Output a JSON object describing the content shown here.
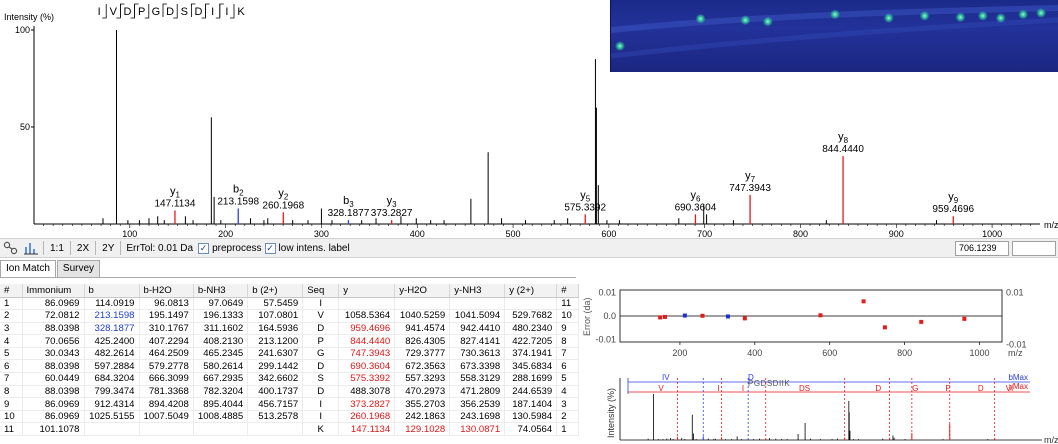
{
  "spectrum": {
    "y_axis_label": "Intensity (%)",
    "y_ticks": [
      {
        "value": 100,
        "label": "100"
      },
      {
        "value": 50,
        "label": "50"
      }
    ],
    "x_axis_label": "m/z",
    "x_ticks": [
      {
        "value": 100,
        "label": "100"
      },
      {
        "value": 200,
        "label": "200"
      },
      {
        "value": 300,
        "label": "300"
      },
      {
        "value": 400,
        "label": "400"
      },
      {
        "value": 500,
        "label": "500"
      },
      {
        "value": 600,
        "label": "600"
      },
      {
        "value": 700,
        "label": "700"
      },
      {
        "value": 800,
        "label": "800"
      },
      {
        "value": 900,
        "label": "900"
      },
      {
        "value": 1000,
        "label": "1000"
      }
    ],
    "xlim": [
      0,
      1050
    ],
    "ylim": [
      0,
      100
    ],
    "sequence": [
      "I",
      "V",
      "D",
      "P",
      "G",
      "D",
      "S",
      "D",
      "I",
      "I",
      "K"
    ],
    "sequence_b_breaks": [
      2,
      3,
      5,
      7,
      8,
      9
    ],
    "sequence_y_breaks": [
      1,
      2,
      3,
      4,
      6,
      8,
      9,
      10
    ],
    "annotated_peaks": [
      {
        "ion": "y",
        "sub": "1",
        "mz": 147.1134,
        "label": "147.1134",
        "intensity": 7,
        "type": "y"
      },
      {
        "ion": "b",
        "sub": "2",
        "mz": 213.1598,
        "label": "213.1598",
        "intensity": 8,
        "type": "b"
      },
      {
        "ion": "y",
        "sub": "2",
        "mz": 260.1968,
        "label": "260.1968",
        "intensity": 6,
        "type": "y"
      },
      {
        "ion": "b",
        "sub": "3",
        "mz": 328.1877,
        "label": "328.1877",
        "intensity": 2,
        "type": "b"
      },
      {
        "ion": "y",
        "sub": "3",
        "mz": 373.2827,
        "label": "373.2827",
        "intensity": 2,
        "type": "y"
      },
      {
        "ion": "y",
        "sub": "5",
        "mz": 575.3392,
        "label": "575.3392",
        "intensity": 5,
        "type": "y"
      },
      {
        "ion": "y",
        "sub": "6",
        "mz": 690.3604,
        "label": "690.3604",
        "intensity": 5,
        "type": "y"
      },
      {
        "ion": "y",
        "sub": "7",
        "mz": 747.3943,
        "label": "747.3943",
        "intensity": 15,
        "type": "y"
      },
      {
        "ion": "y",
        "sub": "8",
        "mz": 844.444,
        "label": "844.4440",
        "intensity": 35,
        "type": "y"
      },
      {
        "ion": "y",
        "sub": "9",
        "mz": 959.4696,
        "label": "959.4696",
        "intensity": 4,
        "type": "y"
      }
    ],
    "other_peaks": [
      {
        "mz": 72,
        "intensity": 3
      },
      {
        "mz": 86.1,
        "intensity": 100
      },
      {
        "mz": 98,
        "intensity": 2
      },
      {
        "mz": 110,
        "intensity": 2
      },
      {
        "mz": 120,
        "intensity": 3
      },
      {
        "mz": 129.1,
        "intensity": 4
      },
      {
        "mz": 136,
        "intensity": 2
      },
      {
        "mz": 158,
        "intensity": 4
      },
      {
        "mz": 166,
        "intensity": 2
      },
      {
        "mz": 185.1,
        "intensity": 55
      },
      {
        "mz": 188,
        "intensity": 14
      },
      {
        "mz": 195,
        "intensity": 2
      },
      {
        "mz": 226,
        "intensity": 3
      },
      {
        "mz": 240,
        "intensity": 2
      },
      {
        "mz": 244,
        "intensity": 3
      },
      {
        "mz": 270,
        "intensity": 2
      },
      {
        "mz": 286,
        "intensity": 2
      },
      {
        "mz": 300,
        "intensity": 8
      },
      {
        "mz": 311,
        "intensity": 2
      },
      {
        "mz": 342,
        "intensity": 2
      },
      {
        "mz": 357,
        "intensity": 3
      },
      {
        "mz": 383,
        "intensity": 4
      },
      {
        "mz": 399,
        "intensity": 3
      },
      {
        "mz": 414,
        "intensity": 2
      },
      {
        "mz": 428,
        "intensity": 2
      },
      {
        "mz": 456,
        "intensity": 13
      },
      {
        "mz": 474,
        "intensity": 37
      },
      {
        "mz": 488,
        "intensity": 3
      },
      {
        "mz": 513,
        "intensity": 2
      },
      {
        "mz": 543,
        "intensity": 2
      },
      {
        "mz": 557,
        "intensity": 3
      },
      {
        "mz": 586,
        "intensity": 85
      },
      {
        "mz": 587,
        "intensity": 60
      },
      {
        "mz": 589,
        "intensity": 20
      },
      {
        "mz": 598,
        "intensity": 2
      },
      {
        "mz": 611,
        "intensity": 2
      },
      {
        "mz": 673,
        "intensity": 3
      },
      {
        "mz": 699,
        "intensity": 10
      },
      {
        "mz": 702,
        "intensity": 5
      },
      {
        "mz": 730,
        "intensity": 2
      },
      {
        "mz": 827,
        "intensity": 2
      },
      {
        "mz": 942,
        "intensity": 2
      }
    ],
    "colors": {
      "b": "#2b3fe0",
      "y": "#e31c1c",
      "other": "#000000",
      "axis": "#000000"
    }
  },
  "toolbar": {
    "ratio_1_1": "1:1",
    "zoom_2x": "2X",
    "zoom_2y": "2Y",
    "err_tol_label": "ErrTol: 0.01 Da",
    "preprocess_label": "preprocess",
    "preprocess_checked": true,
    "low_intens_label": "low intens. label",
    "low_intens_checked": true,
    "mz_value": "706.1239",
    "check_mark": "✓"
  },
  "tabs": [
    {
      "label": "Ion Match",
      "active": true
    },
    {
      "label": "Survey",
      "active": false
    }
  ],
  "table": {
    "headers": [
      "#",
      "Immonium",
      "b",
      "b-H2O",
      "b-NH3",
      "b (2+)",
      "Seq",
      "y",
      "y-H2O",
      "y-NH3",
      "y (2+)",
      "#"
    ],
    "rows": [
      [
        "1",
        "86.0969",
        "114.0919",
        "96.0813",
        "97.0649",
        "57.5459",
        "I",
        "",
        "",
        "",
        "",
        "11"
      ],
      [
        "2",
        "72.0812",
        "213.1598",
        "195.1497",
        "196.1333",
        "107.0801",
        "V",
        "1058.5364",
        "1040.5259",
        "1041.5094",
        "529.7682",
        "10"
      ],
      [
        "3",
        "88.0398",
        "328.1877",
        "310.1767",
        "311.1602",
        "164.5936",
        "D",
        "959.4696",
        "941.4574",
        "942.4410",
        "480.2340",
        "9"
      ],
      [
        "4",
        "70.0656",
        "425.2400",
        "407.2294",
        "408.2130",
        "213.1200",
        "P",
        "844.4440",
        "826.4305",
        "827.4141",
        "422.7205",
        "8"
      ],
      [
        "5",
        "30.0343",
        "482.2614",
        "464.2509",
        "465.2345",
        "241.6307",
        "G",
        "747.3943",
        "729.3777",
        "730.3613",
        "374.1941",
        "7"
      ],
      [
        "6",
        "88.0398",
        "597.2884",
        "579.2778",
        "580.2614",
        "299.1442",
        "D",
        "690.3604",
        "672.3563",
        "673.3398",
        "345.6834",
        "6"
      ],
      [
        "7",
        "60.0449",
        "684.3204",
        "666.3099",
        "667.2935",
        "342.6602",
        "S",
        "575.3392",
        "557.3293",
        "558.3129",
        "288.1699",
        "5"
      ],
      [
        "8",
        "88.0398",
        "799.3474",
        "781.3368",
        "782.3204",
        "400.1737",
        "D",
        "488.3078",
        "470.2973",
        "471.2809",
        "244.6539",
        "4"
      ],
      [
        "9",
        "86.0969",
        "912.4314",
        "894.4208",
        "895.4044",
        "456.7157",
        "I",
        "373.2827",
        "355.2703",
        "356.2539",
        "187.1404",
        "3"
      ],
      [
        "10",
        "86.0969",
        "1025.5155",
        "1007.5049",
        "1008.4885",
        "513.2578",
        "I",
        "260.1968",
        "242.1863",
        "243.1698",
        "130.5984",
        "2"
      ],
      [
        "11",
        "101.1078",
        "",
        "",
        "",
        "",
        "K",
        "147.1134",
        "129.1028",
        "130.0871",
        "74.0564",
        "1"
      ]
    ],
    "highlight": [
      {
        "row": 1,
        "col": 2,
        "color": "blue"
      },
      {
        "row": 2,
        "col": 2,
        "color": "blue"
      },
      {
        "row": 2,
        "col": 7,
        "color": "red"
      },
      {
        "row": 3,
        "col": 7,
        "color": "red"
      },
      {
        "row": 4,
        "col": 7,
        "color": "red"
      },
      {
        "row": 5,
        "col": 7,
        "color": "red"
      },
      {
        "row": 6,
        "col": 7,
        "color": "red"
      },
      {
        "row": 8,
        "col": 7,
        "color": "red"
      },
      {
        "row": 9,
        "col": 7,
        "color": "red"
      },
      {
        "row": 10,
        "col": 7,
        "color": "red"
      },
      {
        "row": 10,
        "col": 8,
        "color": "red"
      },
      {
        "row": 10,
        "col": 9,
        "color": "red"
      }
    ]
  },
  "error_plot": {
    "ylabel": "Error (da)",
    "y_ticks_left": [
      {
        "value": 0.01,
        "label": "0.01"
      },
      {
        "value": 0,
        "label": "0.0"
      },
      {
        "value": -0.01,
        "label": "-0.01"
      }
    ],
    "y_ticks_right": [
      {
        "value": 0.01,
        "label": "0.01"
      },
      {
        "value": -0.01,
        "label": "-0.01"
      }
    ],
    "x_ticks": [
      {
        "value": 200,
        "label": "200"
      },
      {
        "value": 400,
        "label": "400"
      },
      {
        "value": 600,
        "label": "600"
      },
      {
        "value": 800,
        "label": "800"
      },
      {
        "value": 1000,
        "label": "1000"
      }
    ],
    "x_axis_label": "m/z",
    "xlim": [
      40,
      1060
    ],
    "ylim": [
      -0.011,
      0.011
    ],
    "points": [
      {
        "mz": 147.1,
        "err": -0.0006,
        "type": "y"
      },
      {
        "mz": 160,
        "err": -0.0004,
        "type": "y"
      },
      {
        "mz": 213.2,
        "err": 0.0002,
        "type": "b"
      },
      {
        "mz": 260.2,
        "err": 0.0001,
        "type": "y"
      },
      {
        "mz": 328.2,
        "err": -0.0002,
        "type": "b"
      },
      {
        "mz": 373.3,
        "err": -0.001,
        "type": "y"
      },
      {
        "mz": 575.3,
        "err": 0.0003,
        "type": "y"
      },
      {
        "mz": 690.4,
        "err": 0.0062,
        "type": "y"
      },
      {
        "mz": 747.4,
        "err": -0.0048,
        "type": "y"
      },
      {
        "mz": 844.4,
        "err": -0.0025,
        "type": "y"
      },
      {
        "mz": 959.5,
        "err": -0.0012,
        "type": "y"
      }
    ]
  },
  "mini_plot": {
    "ylabel": "Intensity (%)",
    "x_axis_label": "m/z",
    "sequence_text": "PGDSDIIK",
    "b_label": "IV",
    "b_label_d": "D",
    "b_max_label": "bMax",
    "y_max_label": "yMax",
    "y_segments": [
      "V",
      "I",
      "I",
      "DS",
      "D",
      "G",
      "P",
      "D",
      "VI"
    ]
  },
  "inset": {
    "spots": [
      {
        "fx": 0.3,
        "fy": 0.28
      },
      {
        "fx": 0.35,
        "fy": 0.3
      },
      {
        "fx": 0.5,
        "fy": 0.2
      },
      {
        "fx": 0.62,
        "fy": 0.25
      },
      {
        "fx": 0.7,
        "fy": 0.22
      },
      {
        "fx": 0.78,
        "fy": 0.24
      },
      {
        "fx": 0.83,
        "fy": 0.22
      },
      {
        "fx": 0.87,
        "fy": 0.25
      },
      {
        "fx": 0.92,
        "fy": 0.2
      },
      {
        "fx": 0.96,
        "fy": 0.18
      },
      {
        "fx": 0.02,
        "fy": 0.64
      },
      {
        "fx": 0.2,
        "fy": 0.26
      }
    ]
  }
}
